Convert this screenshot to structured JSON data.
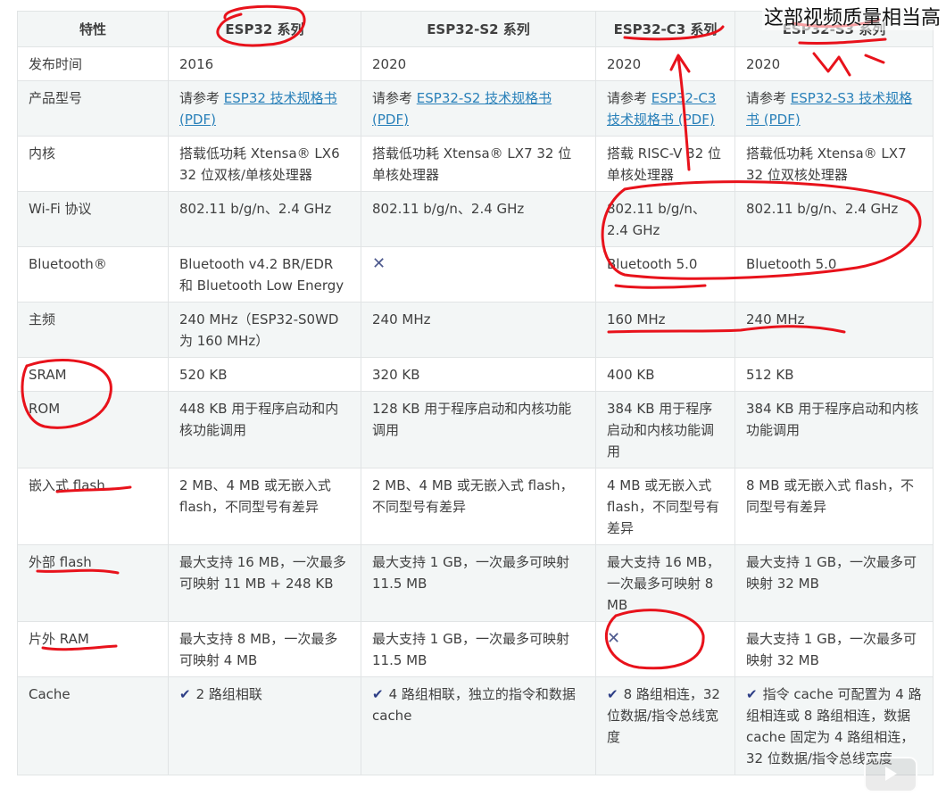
{
  "watermark": "这部视频质量相当高",
  "headers": [
    "特性",
    "ESP32 系列",
    "ESP32-S2 系列",
    "ESP32-C3 系列",
    "ESP32-S3 系列"
  ],
  "rows": [
    {
      "feature": "发布时间",
      "cells": [
        {
          "text": "2016"
        },
        {
          "text": "2020"
        },
        {
          "text": "2020"
        },
        {
          "text": "2020"
        }
      ]
    },
    {
      "feature": "产品型号",
      "cells": [
        {
          "pre": "请参考 ",
          "link": "ESP32 技术规格书 (PDF)"
        },
        {
          "pre": "请参考 ",
          "link": "ESP32-S2 技术规格书 (PDF)"
        },
        {
          "pre": "请参考 ",
          "link": "ESP32-C3 技术规格书 (PDF)"
        },
        {
          "pre": "请参考 ",
          "link": "ESP32-S3 技术规格书 (PDF)"
        }
      ]
    },
    {
      "feature": "内核",
      "cells": [
        {
          "text": "搭载低功耗 Xtensa® LX6 32 位双核/单核处理器"
        },
        {
          "text": "搭载低功耗 Xtensa® LX7 32 位单核处理器"
        },
        {
          "text": "搭载 RISC-V 32 位单核处理器"
        },
        {
          "text": "搭载低功耗 Xtensa® LX7 32 位双核处理器"
        }
      ]
    },
    {
      "feature": "Wi-Fi 协议",
      "cells": [
        {
          "text": "802.11 b/g/n、2.4 GHz"
        },
        {
          "text": "802.11 b/g/n、2.4 GHz"
        },
        {
          "text": "802.11 b/g/n、2.4 GHz"
        },
        {
          "text": "802.11 b/g/n、2.4 GHz"
        }
      ]
    },
    {
      "feature": "Bluetooth®",
      "cells": [
        {
          "text": "Bluetooth v4.2 BR/EDR 和 Bluetooth Low Energy"
        },
        {
          "mark": "✕"
        },
        {
          "text": "Bluetooth 5.0"
        },
        {
          "text": "Bluetooth 5.0"
        }
      ]
    },
    {
      "feature": "主频",
      "cells": [
        {
          "text": "240 MHz（ESP32-S0WD 为 160 MHz）"
        },
        {
          "text": "240 MHz"
        },
        {
          "text": "160 MHz"
        },
        {
          "text": "240 MHz"
        }
      ]
    },
    {
      "feature": "SRAM",
      "cells": [
        {
          "text": "520 KB"
        },
        {
          "text": "320 KB"
        },
        {
          "text": "400 KB"
        },
        {
          "text": "512 KB"
        }
      ]
    },
    {
      "feature": "ROM",
      "cells": [
        {
          "text": "448 KB 用于程序启动和内核功能调用"
        },
        {
          "text": "128 KB 用于程序启动和内核功能调用"
        },
        {
          "text": "384 KB 用于程序启动和内核功能调用"
        },
        {
          "text": "384 KB 用于程序启动和内核功能调用"
        }
      ]
    },
    {
      "feature": "嵌入式 flash",
      "cells": [
        {
          "text": "2 MB、4 MB 或无嵌入式 flash，不同型号有差异"
        },
        {
          "text": "2 MB、4 MB 或无嵌入式 flash，不同型号有差异"
        },
        {
          "text": "4 MB 或无嵌入式 flash，不同型号有差异"
        },
        {
          "text": "8 MB 或无嵌入式 flash，不同型号有差异"
        }
      ]
    },
    {
      "feature": "外部 flash",
      "cells": [
        {
          "text": "最大支持 16 MB，一次最多可映射 11 MB + 248 KB"
        },
        {
          "text": "最大支持 1 GB，一次最多可映射 11.5 MB"
        },
        {
          "text": "最大支持 16 MB，一次最多可映射 8 MB"
        },
        {
          "text": "最大支持 1 GB，一次最多可映射 32 MB"
        }
      ]
    },
    {
      "feature": "片外 RAM",
      "cells": [
        {
          "text": "最大支持 8 MB，一次最多可映射 4 MB"
        },
        {
          "text": "最大支持 1 GB，一次最多可映射 11.5 MB"
        },
        {
          "mark": "✕"
        },
        {
          "text": "最大支持 1 GB，一次最多可映射 32 MB"
        }
      ]
    },
    {
      "feature": "Cache",
      "cells": [
        {
          "check": "✔",
          "text": "2 路组相联"
        },
        {
          "check": "✔",
          "text": "4 路组相联，独立的指令和数据 cache"
        },
        {
          "check": "✔",
          "text": "8 路组相连，32 位数据/指令总线宽度"
        },
        {
          "check": "✔",
          "text": "指令 cache 可配置为 4 路组相连或 8 路组相连，数据 cache 固定为 4 路组相连，32 位数据/指令总线宽度"
        }
      ]
    }
  ]
}
